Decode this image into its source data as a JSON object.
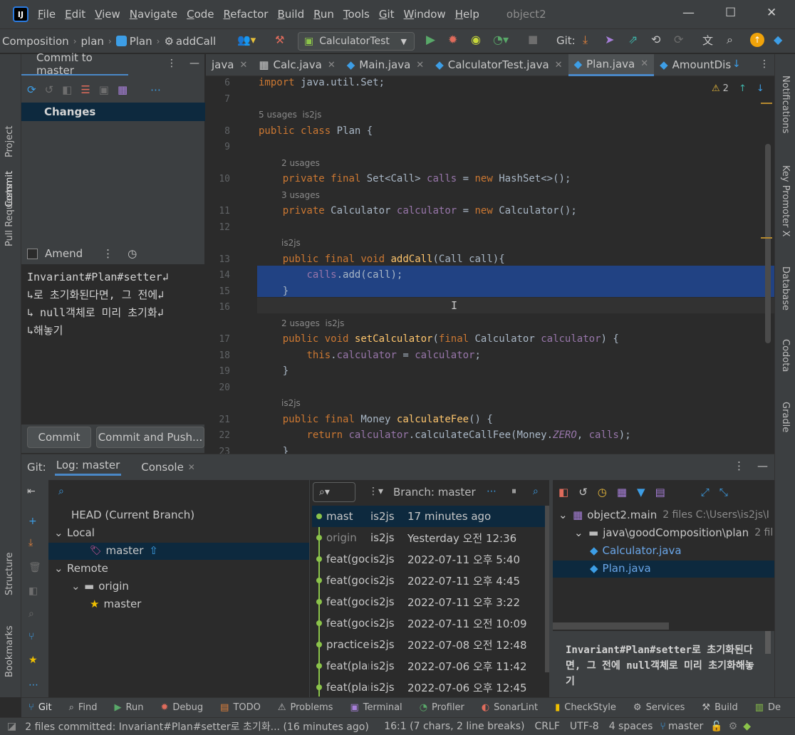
{
  "menu": [
    "File",
    "Edit",
    "View",
    "Navigate",
    "Code",
    "Refactor",
    "Build",
    "Run",
    "Tools",
    "Git",
    "Window",
    "Help"
  ],
  "project_title": "object2",
  "breadcrumbs": [
    "Composition",
    "plan",
    "Plan",
    "addCall"
  ],
  "run_config": "CalculatorTest",
  "git_label": "Git:",
  "left_strip": [
    "Project",
    "Commit",
    "Pull Requests",
    "Structure",
    "Bookmarks"
  ],
  "right_strip": [
    "Notifications",
    "Key Promoter X",
    "Database",
    "Codota",
    "Gradle"
  ],
  "commit": {
    "header": "Commit to master",
    "changes_label": "Changes",
    "amend_label": "Amend",
    "message": "Invariant#Plan#setter↲\n↳로 초기화된다면, 그 전에↲\n↳ null객체로 미리 초기화↲\n↳해놓기",
    "commit_button": "Commit",
    "commit_push_button": "Commit and Push..."
  },
  "tabs": [
    {
      "label": "java",
      "active": false
    },
    {
      "label": "Calc.java",
      "active": false
    },
    {
      "label": "Main.java",
      "active": false
    },
    {
      "label": "CalculatorTest.java",
      "active": false
    },
    {
      "label": "Plan.java",
      "active": true
    },
    {
      "label": "AmountDis",
      "active": false
    }
  ],
  "editor": {
    "warnings": "2",
    "lines": [
      {
        "n": "6",
        "code": "import java.util.Set;"
      },
      {
        "n": "7",
        "code": ""
      },
      {
        "n": "8",
        "code": "public class Plan {",
        "hint": "5 usages  is2js"
      },
      {
        "n": "9",
        "code": ""
      },
      {
        "n": "10",
        "code": "    private final Set<Call> calls = new HashSet<>();",
        "hint": "2 usages"
      },
      {
        "n": "11",
        "code": "    private Calculator calculator = new Calculator();",
        "hint": "3 usages"
      },
      {
        "n": "12",
        "code": ""
      },
      {
        "n": "13",
        "code": "    public final void addCall(Call call){",
        "hint": "is2js"
      },
      {
        "n": "14",
        "code": "        calls.add(call);"
      },
      {
        "n": "15",
        "code": "    }"
      },
      {
        "n": "16",
        "code": ""
      },
      {
        "n": "17",
        "code": "    public void setCalculator(final Calculator calculator) {",
        "hint": "2 usages  is2js"
      },
      {
        "n": "18",
        "code": "        this.calculator = calculator;"
      },
      {
        "n": "19",
        "code": "    }"
      },
      {
        "n": "20",
        "code": ""
      },
      {
        "n": "21",
        "code": "    public final Money calculateFee() {",
        "hint": "is2js"
      },
      {
        "n": "22",
        "code": "        return calculator.calculateCallFee(Money.ZERO, calls);"
      },
      {
        "n": "23",
        "code": "    }"
      }
    ]
  },
  "bottom": {
    "git_label": "Git:",
    "tab_log": "Log: master",
    "tab_console": "Console",
    "branch_filter": "Branch: master",
    "branches": [
      {
        "label": "HEAD (Current Branch)",
        "indent": 0,
        "arrow": ""
      },
      {
        "label": "Local",
        "indent": 0,
        "arrow": "down"
      },
      {
        "label": "master",
        "indent": 2,
        "arrow": "",
        "selected": true
      },
      {
        "label": "Remote",
        "indent": 0,
        "arrow": "down"
      },
      {
        "label": "origin",
        "indent": 1,
        "arrow": "down"
      },
      {
        "label": "master",
        "indent": 2,
        "arrow": ""
      }
    ],
    "log": [
      {
        "subject": "mast",
        "author": "is2js",
        "date": "17 minutes ago",
        "selected": true
      },
      {
        "subject": "origin",
        "author": "is2js",
        "date": "Yesterday 오전 12:36"
      },
      {
        "subject": "feat(goc",
        "author": "is2js",
        "date": "2022-07-11 오후 5:40"
      },
      {
        "subject": "feat(goc",
        "author": "is2js",
        "date": "2022-07-11 오후 4:45"
      },
      {
        "subject": "feat(goc",
        "author": "is2js",
        "date": "2022-07-11 오후 3:22"
      },
      {
        "subject": "feat(goc",
        "author": "is2js",
        "date": "2022-07-11 오전 10:09"
      },
      {
        "subject": "practice(",
        "author": "is2js",
        "date": "2022-07-08 오전 12:48"
      },
      {
        "subject": "feat(plar",
        "author": "is2js",
        "date": "2022-07-06 오후 11:42"
      },
      {
        "subject": "feat(plar",
        "author": "is2js",
        "date": "2022-07-06 오후 12:45"
      }
    ],
    "details_tree": [
      {
        "label": "object2.main",
        "extra": "2 files  C:\\Users\\is2js\\I",
        "indent": 0
      },
      {
        "label": "java\\goodComposition\\plan",
        "extra": "2 fil",
        "indent": 1
      },
      {
        "label": "Calculator.java",
        "extra": "",
        "indent": 2
      },
      {
        "label": "Plan.java",
        "extra": "",
        "indent": 2,
        "selected": true
      }
    ],
    "commit_message": "Invariant#Plan#setter로 초기화된다면, 그 전에 null객체로 미리 초기화해놓기"
  },
  "toolwindows": [
    "Git",
    "Find",
    "Run",
    "Debug",
    "TODO",
    "Problems",
    "Terminal",
    "Profiler",
    "SonarLint",
    "CheckStyle",
    "Services",
    "Build",
    "De"
  ],
  "status": {
    "message": "2 files committed: Invariant#Plan#setter로 초기화... (16 minutes ago)",
    "position": "16:1 (7 chars, 2 line breaks)",
    "line_sep": "CRLF",
    "encoding": "UTF-8",
    "indent": "4 spaces",
    "branch": "master"
  },
  "colors": {
    "accent": "#4a88c7",
    "selection": "#214283",
    "keyword": "#cc7832",
    "field": "#9876aa",
    "method": "#ffc66d",
    "graph": "#8bc34a"
  }
}
